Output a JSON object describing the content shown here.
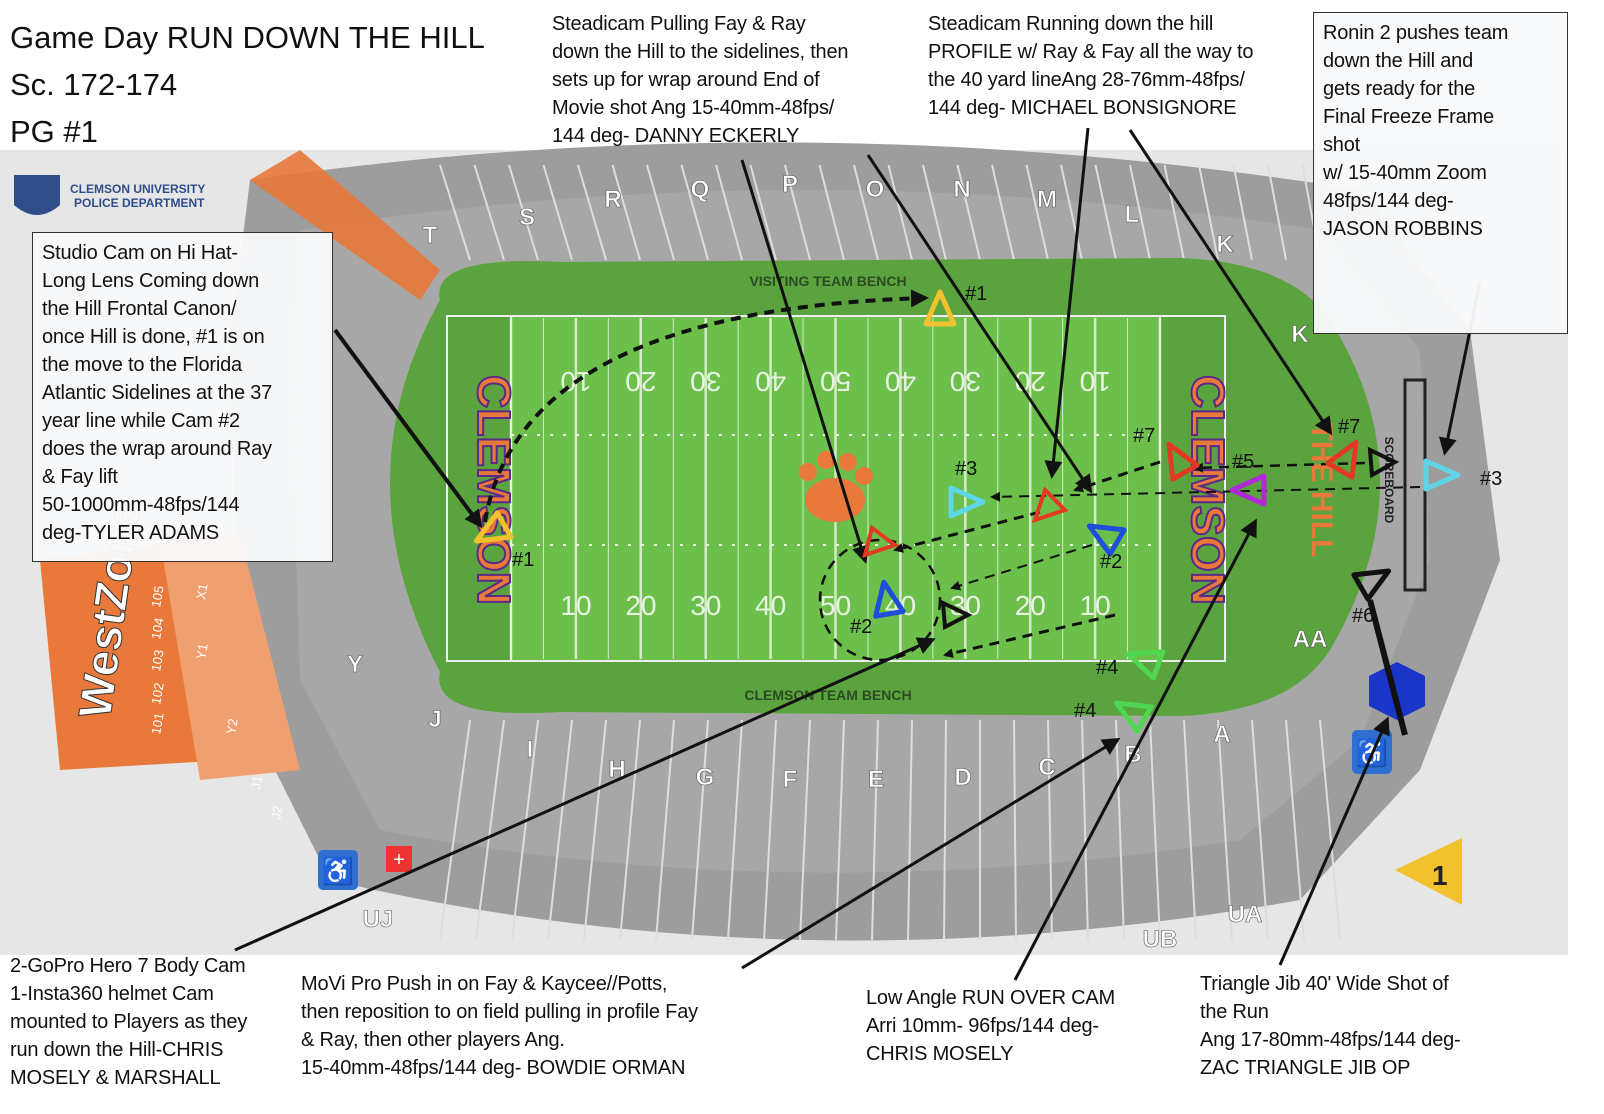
{
  "title": {
    "lines": [
      "Game Day RUN DOWN THE HILL",
      "Sc. 172-174",
      "PG #1"
    ]
  },
  "annotations": {
    "steadicam_pulling": [
      "Steadicam Pulling Fay & Ray",
      "down the Hill to the sidelines, then",
      "sets up for wrap around End of",
      "Movie shot Ang 15-40mm-48fps/",
      "144 deg- DANNY ECKERLY"
    ],
    "steadicam_running": [
      "Steadicam Running down the hill",
      "PROFILE w/ Ray & Fay all the way to",
      "the 40 yard lineAng 28-76mm-48fps/",
      "144 deg- MICHAEL BONSIGNORE"
    ],
    "ronin": [
      "Ronin 2 pushes team",
      "down the Hill and",
      "gets ready for the",
      "Final Freeze Frame",
      "shot",
      "w/ 15-40mm Zoom",
      "48fps/144 deg-",
      "JASON ROBBINS"
    ],
    "studio_cam": [
      "Studio Cam on Hi Hat-",
      "Long Lens Coming down",
      "the Hill Frontal Canon/",
      "once Hill is done, #1 is on",
      "the move to the Florida",
      "Atlantic Sidelines at the 37",
      "year line while Cam #2",
      "does the wrap around Ray",
      "& Fay lift",
      "50-1000mm-48fps/144",
      "deg-TYLER ADAMS"
    ],
    "gopro": [
      "2-GoPro Hero 7 Body Cam",
      "1-Insta360 helmet Cam",
      "mounted to Players as they",
      "run down the Hill-CHRIS",
      "MOSELY & MARSHALL"
    ],
    "movi": [
      "MoVi Pro Push in on Fay & Kaycee//Potts,",
      "then reposition to on field pulling in profile Fay",
      "& Ray, then other players Ang.",
      "15-40mm-48fps/144 deg- BOWDIE ORMAN"
    ],
    "low_angle": [
      "Low Angle RUN OVER CAM",
      "Arri 10mm- 96fps/144 deg-",
      "CHRIS MOSELY"
    ],
    "triangle_jib": [
      "Triangle Jib 40' Wide Shot of",
      "the Run",
      "Ang 17-80mm-48fps/144 deg-",
      "ZAC TRIANGLE JIB OP"
    ]
  },
  "map": {
    "police_label": [
      "CLEMSON UNIVERSITY",
      "POLICE DEPARTMENT"
    ],
    "visiting_bench": "VISITING TEAM BENCH",
    "home_bench": "CLEMSON TEAM BENCH",
    "endzone_text": "CLEMSON",
    "hill_label": "THE HILL",
    "scoreboard": "SCOREBOARD",
    "westzone": "WestZone",
    "yard_numbers": [
      "10",
      "20",
      "30",
      "40",
      "50",
      "40",
      "30",
      "20",
      "10"
    ],
    "sections_top": [
      "T",
      "S",
      "R",
      "Q",
      "P",
      "O",
      "N",
      "M",
      "L",
      "K",
      "K"
    ],
    "sections_bottom": [
      "Y",
      "J",
      "I",
      "H",
      "G",
      "F",
      "E",
      "D",
      "C",
      "B",
      "A",
      "AA"
    ],
    "sections_outer": [
      "UJ",
      "UB",
      "UA"
    ],
    "west_sections": [
      "101",
      "102",
      "103",
      "104",
      "105",
      "X1",
      "Y1",
      "Y2",
      "J1",
      "J2"
    ],
    "gate_number": "1"
  },
  "cameras": [
    {
      "label": "#1",
      "color": "#f2c12e",
      "icon": "triangle-camera-icon"
    },
    {
      "label": "#1",
      "color": "#f2c12e",
      "icon": "triangle-camera-icon"
    },
    {
      "label": "#2",
      "color": "#1f4fd8",
      "icon": "triangle-camera-icon"
    },
    {
      "label": "#2",
      "color": "#1f4fd8",
      "icon": "triangle-camera-icon"
    },
    {
      "label": "#3",
      "color": "#5fd6e8",
      "icon": "triangle-camera-icon"
    },
    {
      "label": "#3",
      "color": "#5fd6e8",
      "icon": "triangle-camera-icon"
    },
    {
      "label": "#4",
      "color": "#4fd84f",
      "icon": "triangle-camera-icon"
    },
    {
      "label": "#4",
      "color": "#4fd84f",
      "icon": "triangle-camera-icon"
    },
    {
      "label": "#5",
      "color": "#b02ad8",
      "icon": "triangle-camera-icon"
    },
    {
      "label": "#6",
      "color": "#111111",
      "icon": "triangle-camera-icon"
    },
    {
      "label": "#7",
      "color": "#e23a22",
      "icon": "triangle-camera-icon"
    },
    {
      "label": "#7",
      "color": "#e23a22",
      "icon": "triangle-camera-icon"
    }
  ],
  "colors": {
    "field": "#5aa33e",
    "turf": "#6cbf4a",
    "stands": "#9a9a9a",
    "orange": "#e8793a",
    "purple": "#5b2a86",
    "jib_marker": "#1a35c8"
  }
}
